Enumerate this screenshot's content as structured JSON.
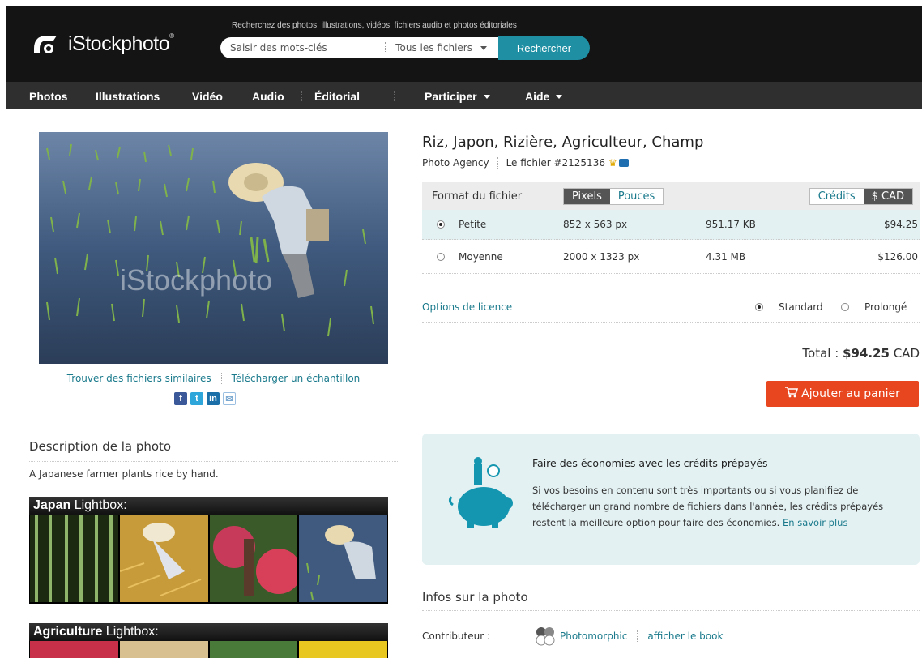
{
  "header": {
    "logo_text": "iStockphoto",
    "logo_mark": "®",
    "search_hint": "Recherchez des photos, illustrations, vidéos, fichiers audio et photos éditoriales",
    "search_placeholder": "Saisir des mots-clés",
    "file_filter": "Tous les fichiers",
    "search_button": "Rechercher"
  },
  "nav": {
    "photos": "Photos",
    "illustrations": "Illustrations",
    "video": "Vidéo",
    "audio": "Audio",
    "editorial": "Éditorial",
    "participate": "Participer",
    "help": "Aide"
  },
  "photo": {
    "watermark": "iStockphoto",
    "similar_link": "Trouver des fichiers similaires",
    "sample_link": "Télécharger un échantillon",
    "social": [
      "f",
      "t",
      "in",
      "✉"
    ]
  },
  "description": {
    "heading": "Description de la photo",
    "text": "A Japanese farmer plants rice by hand."
  },
  "lightboxes": [
    {
      "bold": "Japan",
      "rest": " Lightbox:"
    },
    {
      "bold": "Agriculture",
      "rest": " Lightbox:"
    }
  ],
  "product": {
    "title": "Riz, Japon, Rizière, Agriculteur, Champ",
    "agency": "Photo Agency",
    "file_id": "Le fichier #2125136"
  },
  "format_table": {
    "header": "Format du fichier",
    "unit_pixels": "Pixels",
    "unit_inches": "Pouces",
    "currency_credits": "Crédits",
    "currency_cad": "$ CAD",
    "rows": [
      {
        "size": "Petite",
        "dims": "852 x 563 px",
        "file_size": "951.17 KB",
        "price": "$94.25",
        "selected": true
      },
      {
        "size": "Moyenne",
        "dims": "2000 x 1323 px",
        "file_size": "4.31 MB",
        "price": "$126.00",
        "selected": false
      }
    ]
  },
  "licence": {
    "options_link": "Options de licence",
    "standard": "Standard",
    "extended": "Prolongé"
  },
  "total": {
    "label": "Total : ",
    "amount": "$94.25",
    "currency": " CAD"
  },
  "cart_button": "Ajouter au panier",
  "promo": {
    "heading": "Faire des économies avec les crédits prépayés",
    "body": "Si vos besoins en contenu sont très importants ou si vous planifiez de télécharger un grand nombre de fichiers dans l'année, les crédits prépayés restent la meilleure option pour faire des économies.",
    "link": "En savoir plus"
  },
  "info": {
    "heading": "Infos sur la photo",
    "contributor_label": "Contributeur :",
    "contributor_name": "Photomorphic",
    "portfolio_link": "afficher le book"
  },
  "colors": {
    "accent": "#1a7a8c",
    "search_button": "#1f8fa3",
    "cart_button": "#e8461f",
    "promo_bg": "#e3f1f3"
  }
}
